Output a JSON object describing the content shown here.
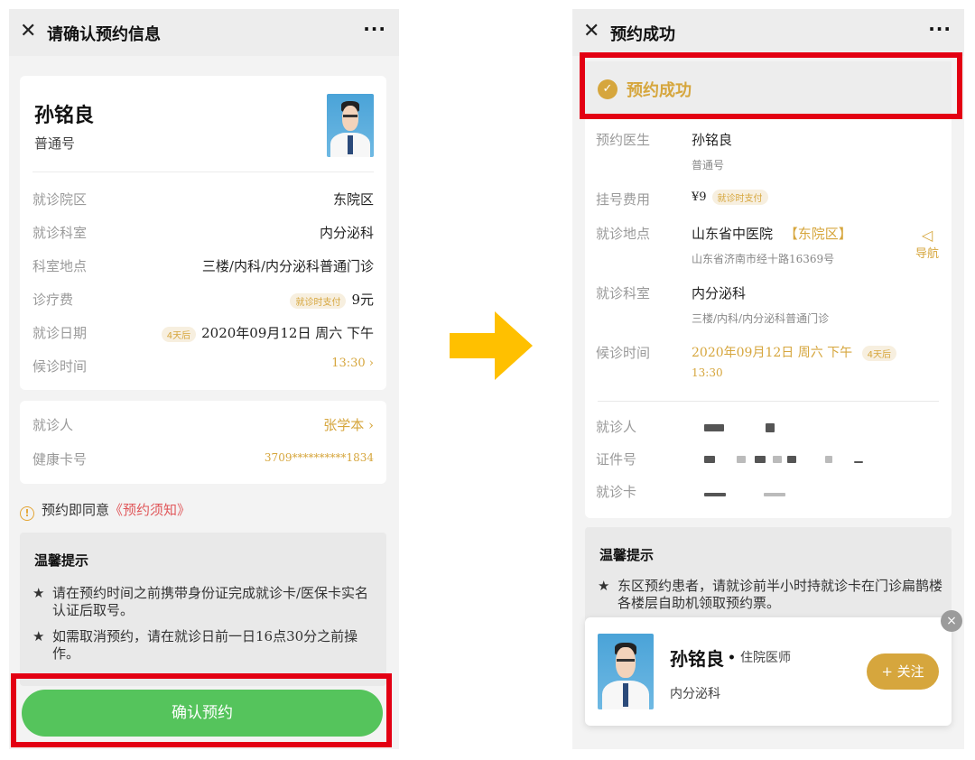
{
  "left": {
    "title": "请确认预约信息",
    "close_icon": "✕",
    "more_icon": "···",
    "doctor": {
      "name": "孙铭良",
      "level": "普通号"
    },
    "rows": [
      {
        "label": "就诊院区",
        "value": "东院区"
      },
      {
        "label": "就诊科室",
        "value": "内分泌科"
      },
      {
        "label": "科室地点",
        "value": "三楼/内科/内分泌科普通门诊"
      },
      {
        "label": "诊疗费",
        "badge": "就诊时支付",
        "value": "9元"
      },
      {
        "label": "就诊日期",
        "badge": "4天后",
        "value": "2020年09月12日 周六 下午"
      },
      {
        "label": "候诊时间",
        "value": "13:30 ›"
      }
    ],
    "patient": {
      "label": "就诊人",
      "value": "张学本 ›"
    },
    "health_card": {
      "label": "健康卡号",
      "value": "3709**********1834"
    },
    "agreement": {
      "icon": "!",
      "prefix": "预约即同意",
      "link": "《预约须知》"
    },
    "tips": {
      "title": "温馨提示",
      "items": [
        "请在预约时间之前携带身份证完成就诊卡/医保卡实名认证后取号。",
        "如需取消预约，请在就诊日前一日16点30分之前操作。"
      ]
    },
    "confirm_label": "确认预约"
  },
  "right": {
    "title": "预约成功",
    "close_icon": "✕",
    "more_icon": "···",
    "success_text": "预约成功",
    "doctor": {
      "label": "预约医生",
      "name": "孙铭良",
      "level": "普通号"
    },
    "fee": {
      "label": "挂号费用",
      "value": "¥9",
      "badge": "就诊时支付"
    },
    "location": {
      "label": "就诊地点",
      "hospital": "山东省中医院",
      "campus": "【东院区】",
      "address": "山东省济南市经十路16369号",
      "nav_label": "导航",
      "nav_icon": "◁"
    },
    "dept": {
      "label": "就诊科室",
      "value": "内分泌科",
      "sub": "三楼/内科/内分泌科普通门诊"
    },
    "wait": {
      "label": "候诊时间",
      "value": "2020年09月12日 周六 下午",
      "badge": "4天后",
      "time": "13:30"
    },
    "patient_label": "就诊人",
    "id_label": "证件号",
    "card_label": "就诊卡",
    "tips": {
      "title": "温馨提示",
      "item": "东区预约患者，请就诊前半小时持就诊卡在门诊扁鹊楼各楼层自助机领取预约票。"
    },
    "popup": {
      "name": "孙铭良",
      "dot": "•",
      "title": "住院医师",
      "dept": "内分泌科",
      "follow": "+ 关注",
      "close": "×"
    }
  },
  "colors": {
    "accent_gold": "#d6a63d",
    "confirm_green": "#55c45c",
    "highlight_red": "#e30013",
    "arrow_yellow": "#ffc000",
    "link_red": "#e0575a"
  }
}
